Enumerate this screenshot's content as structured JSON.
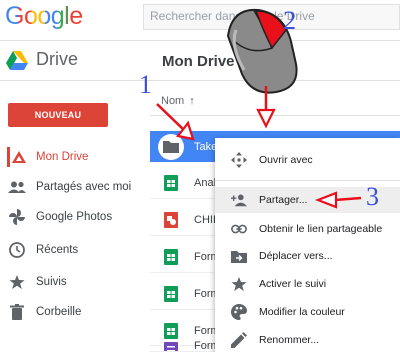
{
  "header": {
    "logo_text": "Google",
    "search_placeholder": "Rechercher dans Google Drive"
  },
  "app": {
    "name": "Drive"
  },
  "breadcrumb": {
    "label": "Mon Drive"
  },
  "sidebar": {
    "new_button": "NOUVEAU",
    "items": [
      {
        "label": "Mon Drive",
        "icon": "my-drive-icon",
        "active": true
      },
      {
        "label": "Partagés avec moi",
        "icon": "shared-people-icon"
      },
      {
        "label": "Google Photos",
        "icon": "photos-pinwheel-icon"
      },
      {
        "label": "Récents",
        "icon": "clock-icon"
      },
      {
        "label": "Suivis",
        "icon": "star-icon"
      },
      {
        "label": "Corbeille",
        "icon": "trash-icon"
      }
    ]
  },
  "file_list": {
    "column_header": "Nom",
    "sort_arrow": "↑",
    "rows": [
      {
        "name": "Take",
        "icon": "folder-icon",
        "selected": true
      },
      {
        "name": "Analy",
        "icon": "sheets-icon"
      },
      {
        "name": "CHIE",
        "icon": "drawing-icon"
      },
      {
        "name": "Form",
        "icon": "sheets-icon"
      },
      {
        "name": "Form",
        "icon": "sheets-icon"
      },
      {
        "name": "Form",
        "icon": "sheets-icon"
      },
      {
        "name": "Form",
        "icon": "forms-icon"
      }
    ]
  },
  "context_menu": {
    "items": [
      {
        "label": "Ouvrir avec",
        "icon": "open-with-icon"
      },
      {
        "label": "Partager...",
        "icon": "add-person-icon",
        "highlighted": true
      },
      {
        "label": "Obtenir le lien partageable",
        "icon": "link-icon"
      },
      {
        "label": "Déplacer vers...",
        "icon": "move-to-folder-icon"
      },
      {
        "label": "Activer le suivi",
        "icon": "star-icon"
      },
      {
        "label": "Modifier la couleur",
        "icon": "palette-icon"
      },
      {
        "label": "Renommer...",
        "icon": "edit-pencil-icon"
      }
    ]
  },
  "annotations": {
    "step1": "1",
    "step2": "2",
    "step3": "3"
  },
  "colors": {
    "accent_red": "#db4437",
    "selection_blue": "#4285f4",
    "annotation_blue": "#3b4fd8",
    "arrow_red": "#e8101a"
  }
}
